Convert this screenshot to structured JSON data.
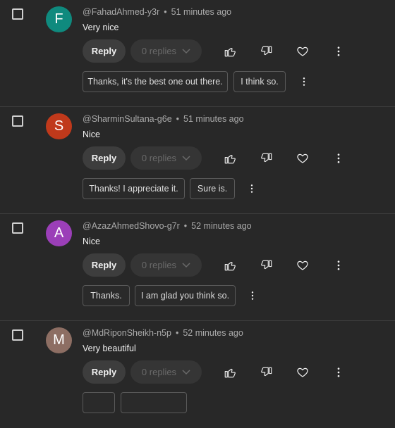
{
  "common": {
    "reply_label": "Reply",
    "replies_label": "0 replies",
    "dot": "•"
  },
  "comments": [
    {
      "avatar_letter": "F",
      "avatar_color": "#0f8a7e",
      "author": "@FahadAhmed-y3r",
      "time": "51 minutes ago",
      "text": "Very nice",
      "suggestions": [
        "Thanks, it's the best one out there.",
        "I think so."
      ]
    },
    {
      "avatar_letter": "S",
      "avatar_color": "#c0391b",
      "author": "@SharminSultana-g6e",
      "time": "51 minutes ago",
      "text": "Nice",
      "suggestions": [
        "Thanks! I appreciate it.",
        "Sure is."
      ]
    },
    {
      "avatar_letter": "A",
      "avatar_color": "#9b3fb8",
      "author": "@AzazAhmedShovo-g7r",
      "time": "52 minutes ago",
      "text": "Nice",
      "suggestions": [
        "Thanks.",
        "I am glad you think so."
      ]
    },
    {
      "avatar_letter": "M",
      "avatar_color": "#8d6e63",
      "author": "@MdRiponSheikh-n5p",
      "time": "52 minutes ago",
      "text": "Very beautiful",
      "suggestions": []
    }
  ]
}
